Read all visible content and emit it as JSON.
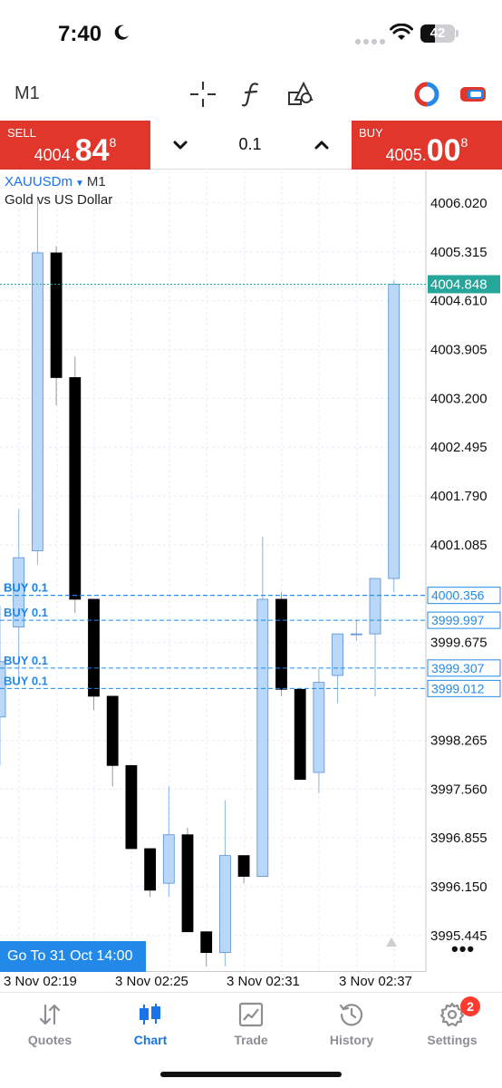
{
  "status_bar": {
    "time": "7:40",
    "battery": "42",
    "battery_level": 0.42
  },
  "toolbar": {
    "timeframe": "M1",
    "icons": [
      "crosshair-icon",
      "function-icon",
      "objects-icon",
      "switch-icon",
      "toggle-icon"
    ]
  },
  "trade": {
    "sell_label": "SELL",
    "sell_price": {
      "main": "4004.",
      "big": "84",
      "small": "8"
    },
    "buy_label": "BUY",
    "buy_price": {
      "main": "4005.",
      "big": "00",
      "small": "8"
    },
    "lot": "0.1"
  },
  "chart": {
    "symbol": "XAUUSDm",
    "timeframe": "M1",
    "description": "Gold vs US Dollar",
    "goto_button": "Go To 31 Oct 14:00",
    "colors": {
      "bull_fill": "#b9d7f8",
      "bear_fill": "#000000",
      "bid_line": "#26a69a",
      "order_line": "#2389e8"
    }
  },
  "chart_data": {
    "type": "candlestick",
    "price_ticks": [
      "4006.020",
      "4005.315",
      "4004.610",
      "4003.905",
      "4003.200",
      "4002.495",
      "4001.790",
      "4001.085",
      "3999.675",
      "3998.265",
      "3997.560",
      "3996.855",
      "3996.150",
      "3995.445"
    ],
    "ylim": [
      3994.92,
      4006.49
    ],
    "time_labels": [
      "3 Nov 02:19",
      "3 Nov 02:25",
      "3 Nov 02:31",
      "3 Nov 02:37"
    ],
    "bid_price": "4004.848",
    "orders": [
      {
        "label": "BUY 0.1",
        "price": "4000.356"
      },
      {
        "label": "BUY 0.1",
        "price": "4000.356"
      },
      {
        "label": "BUY 0.1",
        "price": "3999.997"
      },
      {
        "label": "BUY 0.1",
        "price": "3999.307"
      },
      {
        "label": "BUY 0.1",
        "price": "3999.012"
      }
    ],
    "candles": [
      {
        "o": 3998.6,
        "h": 4000.2,
        "l": 3997.9,
        "c": 3999.4
      },
      {
        "o": 3999.9,
        "h": 4001.6,
        "l": 3999.1,
        "c": 4000.9
      },
      {
        "o": 4001.0,
        "h": 4006.1,
        "l": 4000.8,
        "c": 4005.3
      },
      {
        "o": 4005.3,
        "h": 4005.4,
        "l": 4003.1,
        "c": 4003.5
      },
      {
        "o": 4003.5,
        "h": 4003.8,
        "l": 4000.1,
        "c": 4000.3
      },
      {
        "o": 4000.3,
        "h": 4000.3,
        "l": 3998.7,
        "c": 3998.9
      },
      {
        "o": 3998.9,
        "h": 3998.9,
        "l": 3997.6,
        "c": 3997.9
      },
      {
        "o": 3997.9,
        "h": 3997.9,
        "l": 3996.7,
        "c": 3996.7
      },
      {
        "o": 3996.7,
        "h": 3996.7,
        "l": 3996.0,
        "c": 3996.1
      },
      {
        "o": 3996.2,
        "h": 3997.6,
        "l": 3996.0,
        "c": 3996.9
      },
      {
        "o": 3996.9,
        "h": 3997.0,
        "l": 3995.5,
        "c": 3995.5
      },
      {
        "o": 3995.5,
        "h": 3995.5,
        "l": 3995.0,
        "c": 3995.2
      },
      {
        "o": 3995.2,
        "h": 3997.4,
        "l": 3995.0,
        "c": 3996.6
      },
      {
        "o": 3996.6,
        "h": 3996.6,
        "l": 3996.2,
        "c": 3996.3
      },
      {
        "o": 3996.3,
        "h": 4001.2,
        "l": 3996.3,
        "c": 4000.3
      },
      {
        "o": 4000.3,
        "h": 4000.4,
        "l": 3998.9,
        "c": 3999.0
      },
      {
        "o": 3999.0,
        "h": 3999.0,
        "l": 3997.7,
        "c": 3997.7
      },
      {
        "o": 3997.8,
        "h": 3999.3,
        "l": 3997.5,
        "c": 3999.1
      },
      {
        "o": 3999.2,
        "h": 3999.4,
        "l": 3998.8,
        "c": 3999.8
      },
      {
        "o": 3999.8,
        "h": 4000.0,
        "l": 3999.7,
        "c": 3999.8
      },
      {
        "o": 3999.8,
        "h": 4000.6,
        "l": 3998.9,
        "c": 4000.6
      },
      {
        "o": 4000.6,
        "h": 4004.9,
        "l": 4000.4,
        "c": 4004.848
      }
    ]
  },
  "tabs": [
    {
      "label": "Quotes",
      "icon": "quotes-icon",
      "active": false
    },
    {
      "label": "Chart",
      "icon": "chart-icon",
      "active": true
    },
    {
      "label": "Trade",
      "icon": "trade-icon",
      "active": false
    },
    {
      "label": "History",
      "icon": "history-icon",
      "active": false
    },
    {
      "label": "Settings",
      "icon": "settings-icon",
      "active": false,
      "badge": "2"
    }
  ]
}
